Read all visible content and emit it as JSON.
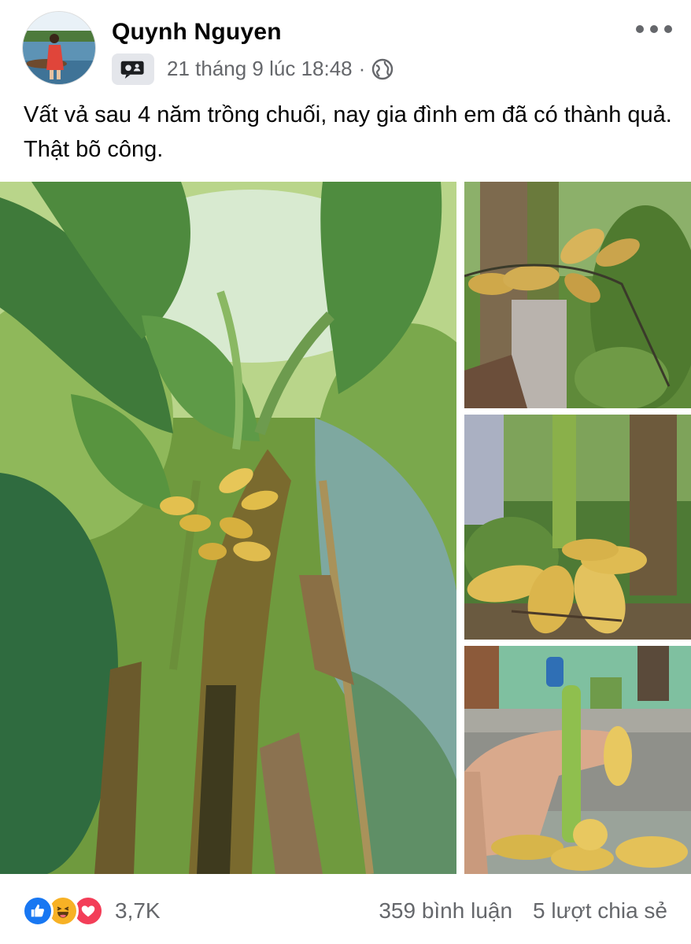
{
  "post": {
    "author": "Quynh Nguyen",
    "date": "21 tháng 9 lúc 18:48",
    "separator": "·",
    "privacy_icon": "globe-icon",
    "text": "Vất vả sau 4 năm trồng chuối, nay gia đình em đã có thành quả. Thật bõ công."
  },
  "photos": [
    {
      "name": "banana-tree-photo"
    },
    {
      "name": "banana-bunch-closeup-photo"
    },
    {
      "name": "banana-hand-stalk-photo"
    },
    {
      "name": "hand-holding-bananas-photo"
    }
  ],
  "reactions": {
    "icons": [
      "like-icon",
      "haha-icon",
      "love-icon"
    ],
    "count": "3,7K"
  },
  "stats": {
    "comments": "359 bình luận",
    "shares": "5 lượt chia sẻ"
  },
  "colors": {
    "like": "#1877f2",
    "haha": "#f7b125",
    "love": "#f33e58",
    "secondary_text": "#65676b"
  }
}
